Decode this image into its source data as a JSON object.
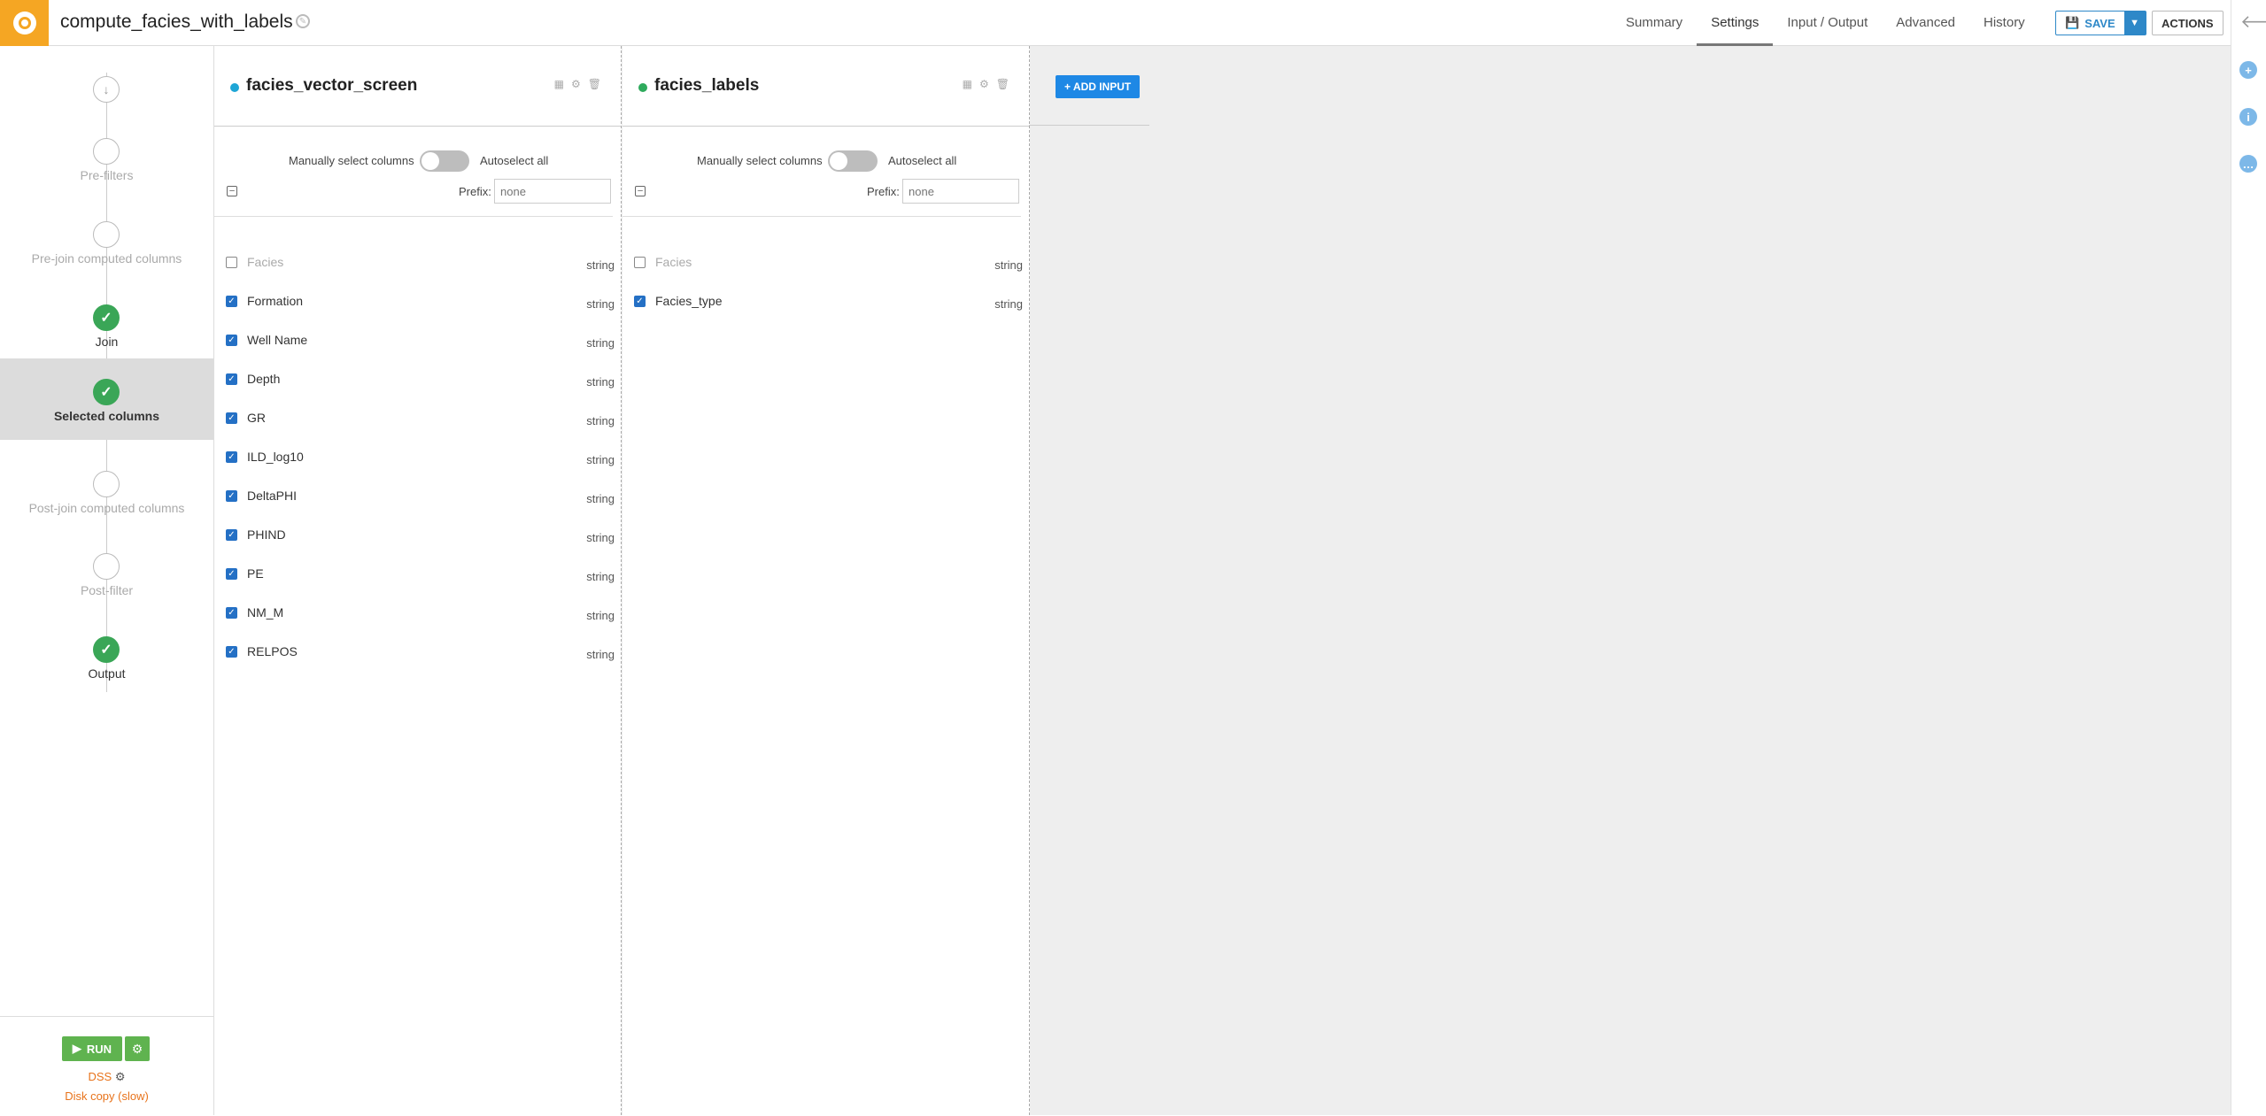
{
  "header": {
    "recipe_title": "compute_facies_with_labels",
    "tabs": [
      {
        "label": "Summary",
        "active": false
      },
      {
        "label": "Settings",
        "active": true
      },
      {
        "label": "Input / Output",
        "active": false
      },
      {
        "label": "Advanced",
        "active": false
      },
      {
        "label": "History",
        "active": false
      }
    ],
    "save_label": "SAVE",
    "actions_label": "ACTIONS"
  },
  "steps": [
    {
      "label": "",
      "state": "start"
    },
    {
      "label": "Pre-filters",
      "state": "pending"
    },
    {
      "label": "Pre-join computed columns",
      "state": "pending"
    },
    {
      "label": "Join",
      "state": "done"
    },
    {
      "label": "Selected columns",
      "state": "done",
      "active": true
    },
    {
      "label": "Post-join computed columns",
      "state": "pending"
    },
    {
      "label": "Post-filter",
      "state": "pending"
    },
    {
      "label": "Output",
      "state": "done"
    }
  ],
  "run": {
    "run_label": "RUN",
    "engine": "DSS",
    "engine_detail": "Disk copy (slow)"
  },
  "datasets": [
    {
      "name": "facies_vector_screen",
      "dot_color": "#1ea6d6",
      "manual_label": "Manually select columns",
      "auto_label": "Autoselect all",
      "prefix_label": "Prefix:",
      "prefix_placeholder": "none",
      "columns": [
        {
          "name": "Facies",
          "type": "string",
          "checked": false
        },
        {
          "name": "Formation",
          "type": "string",
          "checked": true
        },
        {
          "name": "Well Name",
          "type": "string",
          "checked": true
        },
        {
          "name": "Depth",
          "type": "string",
          "checked": true
        },
        {
          "name": "GR",
          "type": "string",
          "checked": true
        },
        {
          "name": "ILD_log10",
          "type": "string",
          "checked": true
        },
        {
          "name": "DeltaPHI",
          "type": "string",
          "checked": true
        },
        {
          "name": "PHIND",
          "type": "string",
          "checked": true
        },
        {
          "name": "PE",
          "type": "string",
          "checked": true
        },
        {
          "name": "NM_M",
          "type": "string",
          "checked": true
        },
        {
          "name": "RELPOS",
          "type": "string",
          "checked": true
        }
      ]
    },
    {
      "name": "facies_labels",
      "dot_color": "#2eaa5c",
      "manual_label": "Manually select columns",
      "auto_label": "Autoselect all",
      "prefix_label": "Prefix:",
      "prefix_placeholder": "none",
      "columns": [
        {
          "name": "Facies",
          "type": "string",
          "checked": false
        },
        {
          "name": "Facies_type",
          "type": "string",
          "checked": true
        }
      ]
    }
  ],
  "add_input_label": "+ ADD INPUT",
  "colors": {
    "accent": "#f5a623",
    "primary": "#1e88e5",
    "success": "#3aa657",
    "run": "#5fb34f",
    "engine": "#e8731b"
  },
  "icons": {
    "edit": "pencil-icon",
    "back": "arrow-left-icon",
    "rail": [
      "plus-circle-icon",
      "info-icon",
      "chat-icon"
    ]
  }
}
